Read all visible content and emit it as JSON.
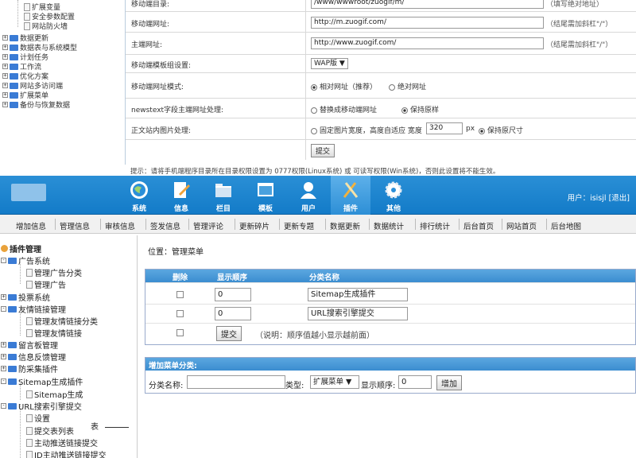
{
  "top_tree": {
    "items": [
      {
        "label": "扩展变量",
        "type": "doc"
      },
      {
        "label": "安全参数配置",
        "type": "doc"
      },
      {
        "label": "网站防火墙",
        "type": "doc"
      },
      {
        "label": "数据更新",
        "type": "folder"
      },
      {
        "label": "数据表与系统模型",
        "type": "folder"
      },
      {
        "label": "计划任务",
        "type": "folder"
      },
      {
        "label": "工作流",
        "type": "folder"
      },
      {
        "label": "优化方案",
        "type": "folder"
      },
      {
        "label": "网站多访问端",
        "type": "folder"
      },
      {
        "label": "扩展菜单",
        "type": "folder"
      },
      {
        "label": "备份与恢复数据",
        "type": "folder"
      }
    ]
  },
  "top_form": {
    "rows": [
      {
        "label": "移动端目录:",
        "value": "/www/wwwroot/zuogif/m/",
        "note": "（填写绝对地址）"
      },
      {
        "label": "移动端网址:",
        "value": "http://m.zuogif.com/",
        "note": "（结尾需加斜杠\"/\"）"
      },
      {
        "label": "主端网址:",
        "value": "http://www.zuogif.com/",
        "note": "（结尾需加斜杠\"/\"）"
      }
    ],
    "template_label": "移动端模板组设置:",
    "template_value": "WAP版 ▼",
    "mode_label": "移动端网址模式:",
    "mode_opts": [
      "相对网址（推荐）",
      "绝对网址"
    ],
    "newstext_label": "newstext字段主端网址处理:",
    "newstext_opts": [
      "替换成移动端网址",
      "保持原样"
    ],
    "img_label": "正文站内图片处理:",
    "img_opt1": "固定图片宽度，高度自适应 宽度",
    "img_width": "320",
    "img_unit": "px",
    "img_opt2": "保持原尺寸",
    "submit": "提交",
    "tip": "提示：请将手机端程序目录所在目录权限设置为 0777权限(Linux系统) 或 可读写权限(Win系统)，否则此设置将不能生效。"
  },
  "header": {
    "nav": [
      {
        "label": "系统",
        "icon": "globe-icon"
      },
      {
        "label": "信息",
        "icon": "edit-icon"
      },
      {
        "label": "栏目",
        "icon": "folder-icon"
      },
      {
        "label": "模板",
        "icon": "template-icon"
      },
      {
        "label": "用户",
        "icon": "user-icon"
      },
      {
        "label": "插件",
        "icon": "plugin-icon"
      },
      {
        "label": "其他",
        "icon": "gear-icon"
      }
    ],
    "user_text": "用户：isisjl",
    "logout": "[退出]"
  },
  "menu": [
    "增加信息",
    "管理信息",
    "审核信息",
    "签发信息",
    "管理评论",
    "更新碎片",
    "更新专题",
    "数据更新",
    "数据统计",
    "排行统计",
    "后台首页",
    "网站首页",
    "后台地图"
  ],
  "left_tree": {
    "title": "插件管理",
    "items": [
      {
        "label": "广告系统",
        "level": 0,
        "type": "folder",
        "pm": "-"
      },
      {
        "label": "管理广告分类",
        "level": 1,
        "type": "doc"
      },
      {
        "label": "管理广告",
        "level": 1,
        "type": "doc"
      },
      {
        "label": "投票系统",
        "level": 0,
        "type": "folder",
        "pm": "+"
      },
      {
        "label": "友情链接管理",
        "level": 0,
        "type": "folder",
        "pm": "-"
      },
      {
        "label": "管理友情链接分类",
        "level": 1,
        "type": "doc"
      },
      {
        "label": "管理友情链接",
        "level": 1,
        "type": "doc"
      },
      {
        "label": "留言板管理",
        "level": 0,
        "type": "folder",
        "pm": "+"
      },
      {
        "label": "信息反馈管理",
        "level": 0,
        "type": "folder",
        "pm": "+"
      },
      {
        "label": "防采集插件",
        "level": 0,
        "type": "folder",
        "pm": "+"
      },
      {
        "label": "Sitemap生成插件",
        "level": 0,
        "type": "folder",
        "pm": "-"
      },
      {
        "label": "Sitemap生成",
        "level": 1,
        "type": "doc"
      },
      {
        "label": "URL搜索引擎提交",
        "level": 0,
        "type": "folder",
        "pm": "-"
      },
      {
        "label": "设置",
        "level": 1,
        "type": "doc"
      },
      {
        "label": "提交表列表",
        "level": 1,
        "type": "doc"
      },
      {
        "label": "主动推送链接提交",
        "level": 1,
        "type": "doc"
      },
      {
        "label": "ID主动推送链接提交",
        "level": 1,
        "type": "doc"
      }
    ],
    "annotation": "表"
  },
  "main": {
    "crumb": "位置：管理菜单",
    "table": {
      "headers": [
        "删除",
        "显示顺序",
        "分类名称"
      ],
      "rows": [
        {
          "order": "0",
          "name": "Sitemap生成插件"
        },
        {
          "order": "0",
          "name": "URL搜索引擎提交"
        }
      ],
      "submit": "提交",
      "note": "（说明：顺序值越小显示越前面）"
    },
    "add": {
      "title": "增加菜单分类:",
      "name_label": "分类名称:",
      "type_label": "类型:",
      "type_value": "扩展菜单 ▼",
      "order_label": "显示顺序:",
      "order_value": "0",
      "add_button": "增加"
    }
  }
}
